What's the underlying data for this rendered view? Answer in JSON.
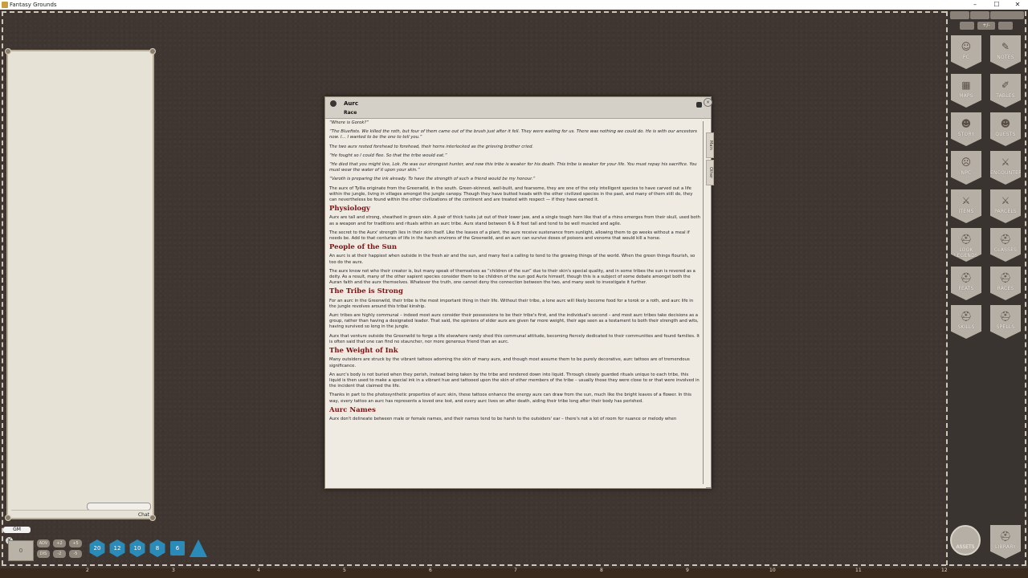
{
  "window": {
    "title": "Fantasy Grounds",
    "minimize": "–",
    "maximize": "☐",
    "close": "✕"
  },
  "chat": {
    "button_label": "Chat"
  },
  "bottom_left": {
    "gm_label": "GM",
    "reset_symbol": "✕",
    "modifier_value": "0",
    "buttons": [
      "ADV",
      "+2",
      "+5",
      "DIS",
      "-2",
      "-5"
    ]
  },
  "dice": [
    "20",
    "12",
    "10",
    "8",
    "6",
    ""
  ],
  "ruler": [
    "2",
    "3",
    "4",
    "5",
    "6",
    "7",
    "8",
    "9",
    "10",
    "11",
    "12"
  ],
  "sidebar": {
    "top_tools": [
      "",
      "",
      "",
      "",
      "",
      "",
      "+/-",
      ""
    ],
    "buttons": [
      "PC",
      "NOTES",
      "MAPS",
      "TABLES",
      "STORY",
      "QUESTS",
      "NPC",
      "ENCOUNTERS",
      "ITEMS",
      "PARCELS",
      "LOOK LEGENDS",
      "CLASSES",
      "FEATS",
      "RACES",
      "SKILLS",
      "SPELLS"
    ],
    "bottom_buttons": [
      "ASSETS",
      "LIBRARY"
    ]
  },
  "record": {
    "name": "Aurc",
    "type": "Race",
    "tabs": [
      "Main",
      "Other"
    ],
    "quotes": [
      "“Where is Gorok?”",
      "“The Bluefists. We killed the roth, but four of them came out of the brush just after it fell. They were waiting for us. There was nothing we could do. He is with our ancestors now. I… I wanted to be the one to tell you.”",
      "The two aurx rested forehead to forehead, their horns interlocked as the grieving brother cried.",
      "“He fought so I could flee. So that the tribe would eat.”",
      "“He died that you might live, Lok. He was our strongest hunter, and now this tribe is weaker for his death. This tribe is weaker for your life. You must repay his sacrifice. You must wear the water of it upon your skin.”",
      "“Varoth is preparing the ink already. To have the strength of such a friend would be my honour.”"
    ],
    "intro": "The aurx of Tyllia originate from the Greenwild, in the south. Green-skinned, well-built, and fearsome, they are one of the only intelligent species to have carved out a life within the jungle, living in villages amongst the jungle canopy. Though they have butted heads with the other civilized species in the past, and many of them still do, they can nevertheless be found within the other civilizations of the continent and are treated with respect — if they have earned it.",
    "sections": [
      {
        "heading": "Physiology",
        "paragraphs": [
          "Aurx are tall and strong, sheathed in green skin. A pair of thick tusks jut out of their lower jaw, and a single tough horn like that of a rhino emerges from their skull, used both as a weapon and for traditions and rituals within an aurc tribe. Aurx stand between 6 & 8 feet tall and tend to be well muscled and agile.",
          "The secret to the Aurx' strength lies in their skin itself. Like the leaves of a plant, the aurx receive sustenance from sunlight, allowing them to go weeks without a meal if needs be. Add to that centuries of life in the harsh environs of the Greenwild, and an aurc can survive doses of poisons and venoms that would kill a horse."
        ]
      },
      {
        "heading": "People of the Sun",
        "paragraphs": [
          "An aurc is at their happiest when outside in the fresh air and the sun, and many feel a calling to tend to the growing things of the world. When the green things flourish, so too do the aurx.",
          "The aurx know not who their creator is, but many speak of themselves as “children of the sun” due to their skin's special quality, and in some tribes the sun is revered as a deity. As a result, many of the other sapient species consider them to be children of the sun god Aurix himself, though this is a subject of some debate amongst both the Auran faith and the aurx themselves. Whatever the truth, one cannot deny the connection between the two, and many seek to investigate it further."
        ]
      },
      {
        "heading": "The Tribe is Strong",
        "paragraphs": [
          "For an aurc in the Greenwild, their tribe is the most important thing in their life. Without their tribe, a lone aurc will likely become food for a torok or a roth, and aurc life in the jungle revolves around this tribal kinship.",
          "Aurc tribes are highly communal – indeed most aurx consider their possessions to be their tribe's first, and the individual's second – and most aurc tribes take decisions as a group, rather than having a designated leader. That said, the opinions of elder aurx are given far more weight, their age seen as a testament to both their strength and wits, having survived so long in the jungle.",
          "Aurx that venture outside the Greenwild to forge a life elsewhere rarely shed this communal attitude, becoming fiercely dedicated to their communities and found families. It is often said that one can find no stauncher, nor more generous friend than an aurc."
        ]
      },
      {
        "heading": "The Weight of Ink",
        "paragraphs": [
          "Many outsiders are struck by the vibrant tattoos adorning the skin of many aurx, and though most assume them to be purely decorative, aurc tattoos are of tremendous significance.",
          "An aurc's body is not buried when they perish, instead being taken by the tribe and rendered down into liquid. Through closely guarded rituals unique to each tribe, this liquid is then used to make a special ink in a vibrant hue and tattooed upon the skin of other members of the tribe – usually those they were close to or that were involved in the incident that claimed the life.",
          "Thanks in part to the photosynthetic properties of aurc skin, these tattoos enhance the energy aurx can draw from the sun, much like the bright leaves of a flower. In this way, every tattoo an aurc has represents a loved one lost, and every aurc lives on after death, aiding their tribe long after their body has perished."
        ]
      },
      {
        "heading": "Aurc Names",
        "paragraphs": [
          "Aurx don't delineate between male or female names, and their names tend to be harsh to the outsiders' ear – there's not a lot of room for nuance or melody when"
        ]
      }
    ]
  }
}
